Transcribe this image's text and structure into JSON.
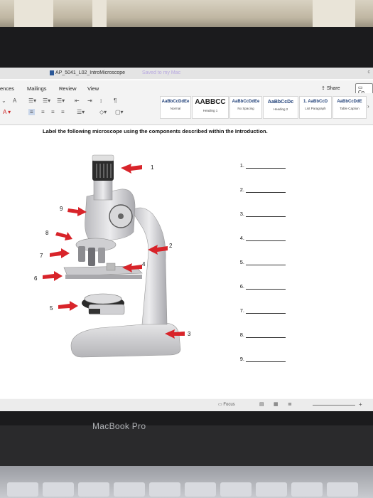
{
  "window": {
    "title": "AP_5041_L02_IntroMicroscope",
    "saved_status": "Saved to my Mac"
  },
  "ribbon": {
    "tabs": [
      "ences",
      "Mailings",
      "Review",
      "View"
    ],
    "share_label": "Share",
    "co_label": "Co",
    "styles": [
      {
        "sample": "AaBbCcDdEe",
        "name": "Normal"
      },
      {
        "sample": "AABBCC",
        "name": "Heading 1"
      },
      {
        "sample": "AaBbCcDdEe",
        "name": "No Spacing"
      },
      {
        "sample": "AaBbCcDc",
        "name": "Heading 2"
      },
      {
        "sample": "1. AaBbCcD",
        "name": "List Paragraph"
      },
      {
        "sample": "AaBbCcDdE",
        "name": "Table Caption"
      }
    ]
  },
  "document": {
    "instruction": "Label the following microscope using the components described within the Introduction.",
    "answer_numbers": [
      "1.",
      "2.",
      "3.",
      "4.",
      "5.",
      "6.",
      "7.",
      "8.",
      "9."
    ],
    "diagram_labels": [
      "1",
      "2",
      "3",
      "4",
      "5",
      "6",
      "7",
      "8",
      "9"
    ]
  },
  "statusbar": {
    "focus_label": "Focus",
    "zoom_plus": "+"
  },
  "bezel": {
    "brand": "MacBook Pro"
  },
  "colors": {
    "arrow": "#d8242a",
    "microscope_body": "#d9d9db",
    "heading_blue": "#1f3f77"
  }
}
